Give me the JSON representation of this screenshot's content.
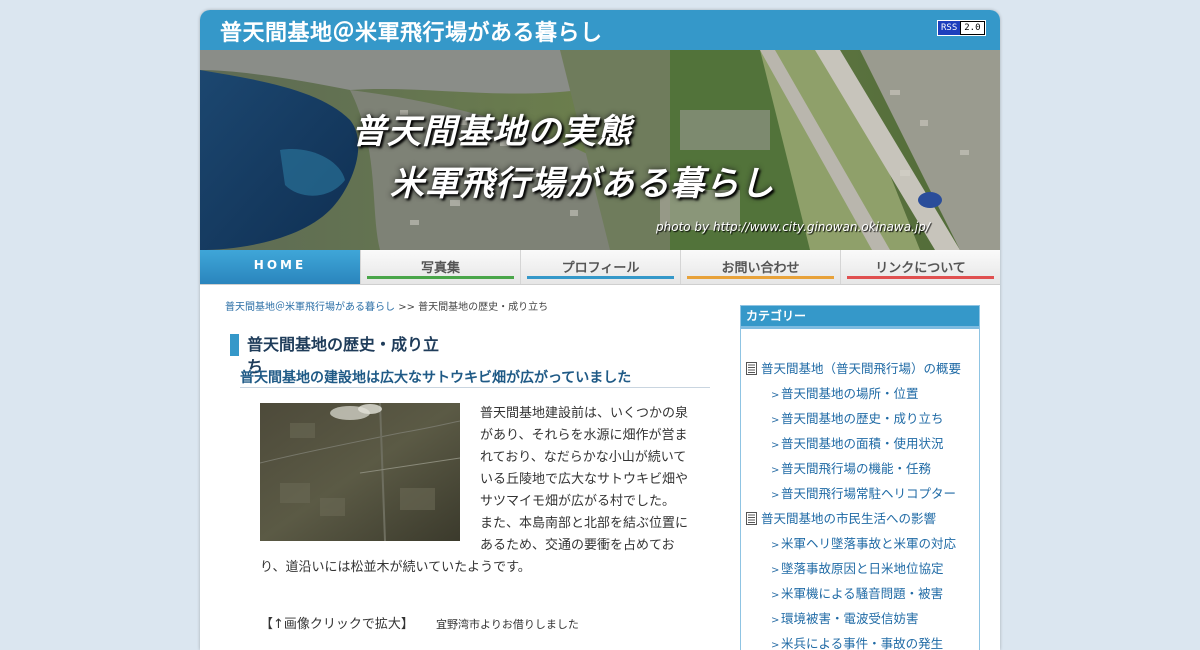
{
  "header": {
    "site_title": "普天間基地＠米軍飛行場がある暮らし",
    "rss_left": "RSS",
    "rss_right": "2.0"
  },
  "banner": {
    "line1": "普天間基地の実態",
    "line2": "米軍飛行場がある暮らし",
    "credit": "photo by http://www.city.ginowan.okinawa.jp/"
  },
  "nav": {
    "items": [
      {
        "label": "HOME",
        "color": "#2a85bd"
      },
      {
        "label": "写真集",
        "color": "#4aa64a"
      },
      {
        "label": "プロフィール",
        "color": "#3598c9"
      },
      {
        "label": "お問い合わせ",
        "color": "#e8a23a"
      },
      {
        "label": "リンクについて",
        "color": "#e05050"
      }
    ]
  },
  "breadcrumb": {
    "home_link": "普天間基地＠米軍飛行場がある暮らし",
    "separator": ">>",
    "current": "普天間基地の歴史・成り立ち"
  },
  "article": {
    "title": "普天間基地の歴史・成り立ち",
    "section_title": "普天間基地の建設地は広大なサトウキビ畑が広がっていました",
    "paragraph1": "普天間基地建設前は、いくつかの泉があり、それらを水源に畑作が営まれており、なだらかな小山が続いている丘陵地で広大なサトウキビ畑やサツマイモ畑が広がる村でした。",
    "paragraph2": "また、本島南部と北部を結ぶ位置にあるため、交通の要衝を占めており、道沿いには松並木が続いていたようです。",
    "caption": "【↑画像クリックで拡大】",
    "caption_note": "宜野湾市よりお借りしました"
  },
  "sidebar": {
    "header": "カテゴリー",
    "groups": [
      {
        "label": "普天間基地（普天間飛行場）の概要",
        "items": [
          "普天間基地の場所・位置",
          "普天間基地の歴史・成り立ち",
          "普天間基地の面積・使用状況",
          "普天間飛行場の機能・任務",
          "普天間飛行場常駐ヘリコプター"
        ]
      },
      {
        "label": "普天間基地の市民生活への影響",
        "items": [
          "米軍ヘリ墜落事故と米軍の対応",
          "墜落事故原因と日米地位協定",
          "米軍機による騒音問題・被害",
          "環境被害・電波受信妨害",
          "米兵による事件・事故の発生"
        ]
      }
    ]
  },
  "colors": {
    "accent": "#3598c9",
    "background": "#dbe6f0",
    "link": "#1f6aa5"
  }
}
